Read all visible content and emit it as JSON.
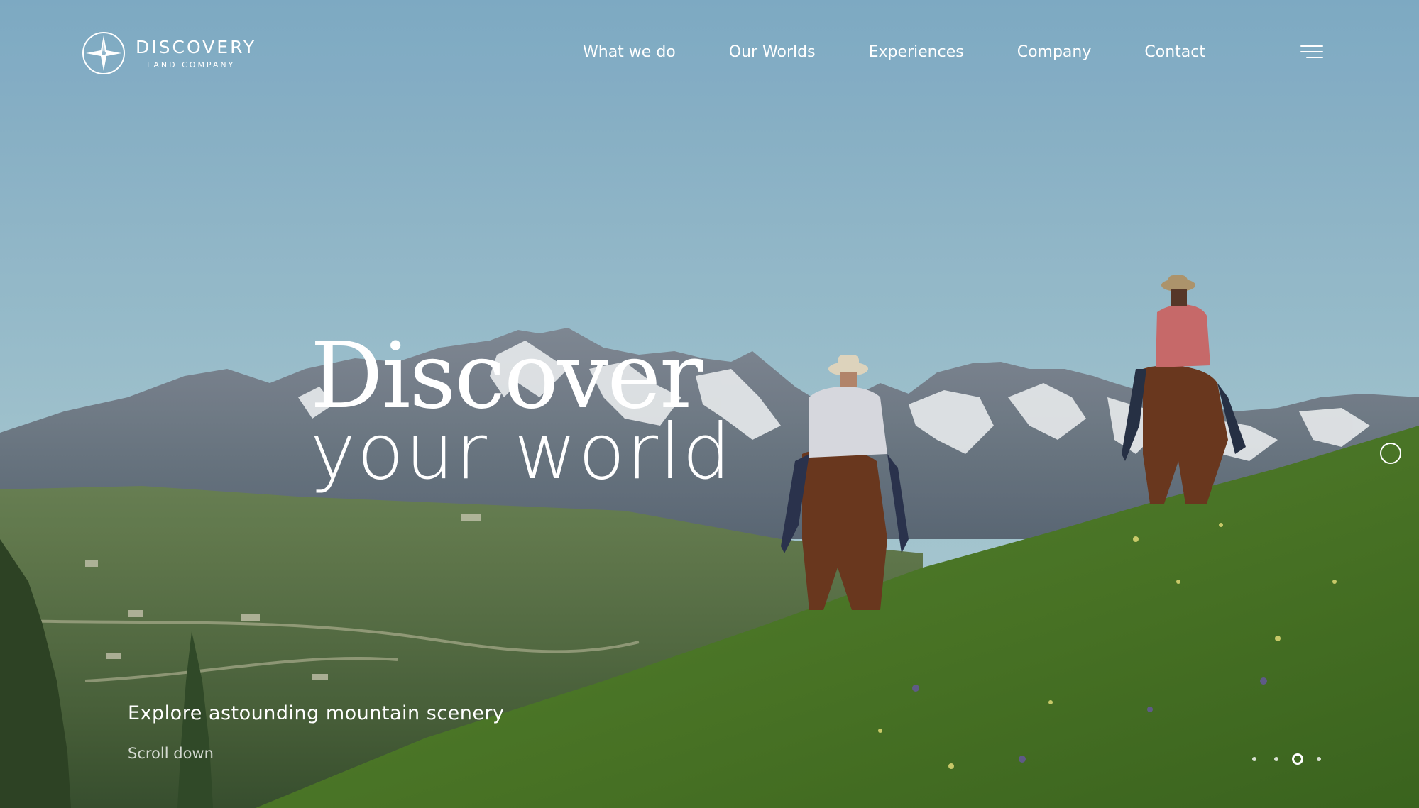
{
  "brand": {
    "name": "DISCOVERY",
    "tagline": "LAND COMPANY"
  },
  "nav": {
    "items": [
      "What we do",
      "Our Worlds",
      "Experiences",
      "Company",
      "Contact"
    ]
  },
  "hero": {
    "headline_line1": "Discover",
    "headline_line2": "your world",
    "caption": "Explore astounding mountain scenery",
    "scroll_label": "Scroll down"
  },
  "slider": {
    "count": 4,
    "active_index": 2
  },
  "icons": {
    "logo": "compass-star-icon",
    "menu": "hamburger-menu-icon",
    "side": "circle-ring-icon"
  },
  "colors": {
    "sky_top": "#86b3cc",
    "sky_bottom": "#a8cbd6",
    "mountain": "#7a8590",
    "snow": "#eef2f4",
    "valley": "#5c7548",
    "meadow": "#4e7a2c",
    "text": "#ffffff"
  }
}
